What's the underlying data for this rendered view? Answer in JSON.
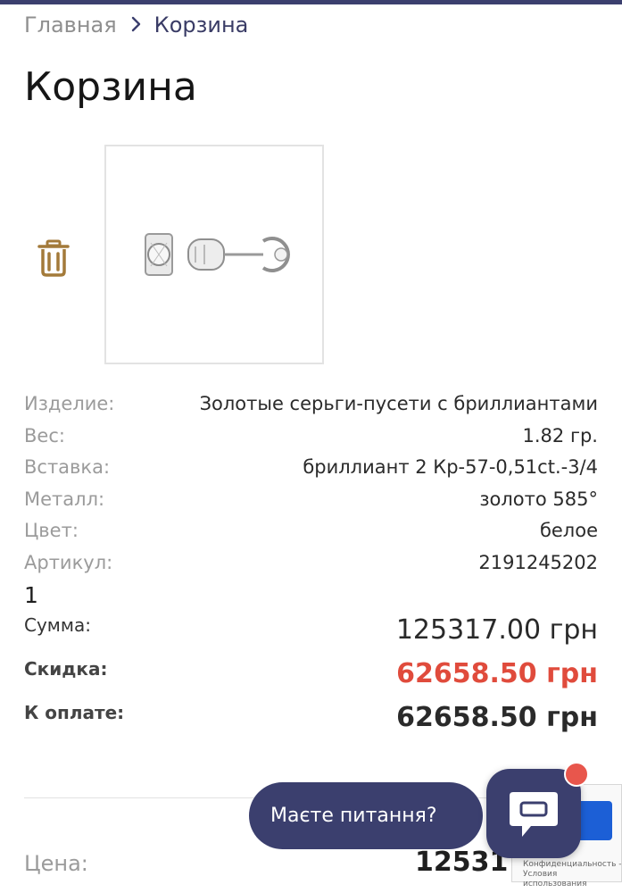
{
  "colors": {
    "accent": "#3b3f6e",
    "discount": "#e04b3c",
    "trash": "#a37a3a",
    "notification": "#e8564c"
  },
  "breadcrumb": {
    "home": "Главная",
    "separator_icon": "chevron-right-icon",
    "current": "Корзина"
  },
  "page": {
    "title": "Корзина"
  },
  "item": {
    "delete_icon": "trash-icon",
    "image_alt": "earrings-image",
    "specs": [
      {
        "label": "Изделие:",
        "value": "Золотые серьги-пусети с бриллиантами"
      },
      {
        "label": "Вес:",
        "value": "1.82 гр."
      },
      {
        "label": "Вставка:",
        "value": "бриллиант 2 Кр-57-0,51ct.-3/4"
      },
      {
        "label": "Металл:",
        "value": "золото 585°"
      },
      {
        "label": "Цвет:",
        "value": "белое"
      },
      {
        "label": "Артикул:",
        "value": "2191245202"
      }
    ],
    "quantity": "1"
  },
  "totals": {
    "sum_label": "Сумма:",
    "sum_value": "125317.00 грн",
    "discount_label": "Скидка:",
    "discount_value": "62658.50 грн",
    "pay_label": "К оплате:",
    "pay_value": "62658.50 грн"
  },
  "price": {
    "label": "Цена:",
    "value": "125317."
  },
  "chat": {
    "prompt": "Маєте питання?",
    "icon": "chat-icon"
  },
  "recaptcha": {
    "links": "Конфиденциальность - Условия использования"
  }
}
